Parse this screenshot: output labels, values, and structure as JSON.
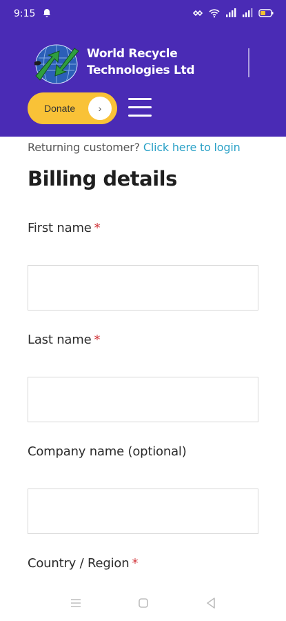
{
  "status_bar": {
    "time": "9:15",
    "icons": [
      "notification-bell-icon",
      "data-saver-icon",
      "wifi-icon",
      "signal-icon",
      "signal-icon",
      "battery-icon"
    ]
  },
  "header": {
    "brand_line1": "World Recycle",
    "brand_line2": "Technologies Ltd",
    "donate_label": "Donate",
    "donate_arrow": "›"
  },
  "login": {
    "prompt": "Returning customer?",
    "link": "Click here to login"
  },
  "form": {
    "title": "Billing details",
    "required_marker": "*",
    "fields": [
      {
        "label": "First name",
        "required": true,
        "value": ""
      },
      {
        "label": "Last name",
        "required": true,
        "value": ""
      },
      {
        "label": "Company name (optional)",
        "required": false,
        "value": ""
      },
      {
        "label": "Country / Region",
        "required": true,
        "value": ""
      }
    ]
  },
  "colors": {
    "header_bg": "#4a2bb5",
    "donate_bg": "#f9c237",
    "link": "#2aa1c7",
    "required": "#d2373c"
  },
  "nav": [
    "menu-icon",
    "home-square-icon",
    "back-triangle-icon"
  ]
}
